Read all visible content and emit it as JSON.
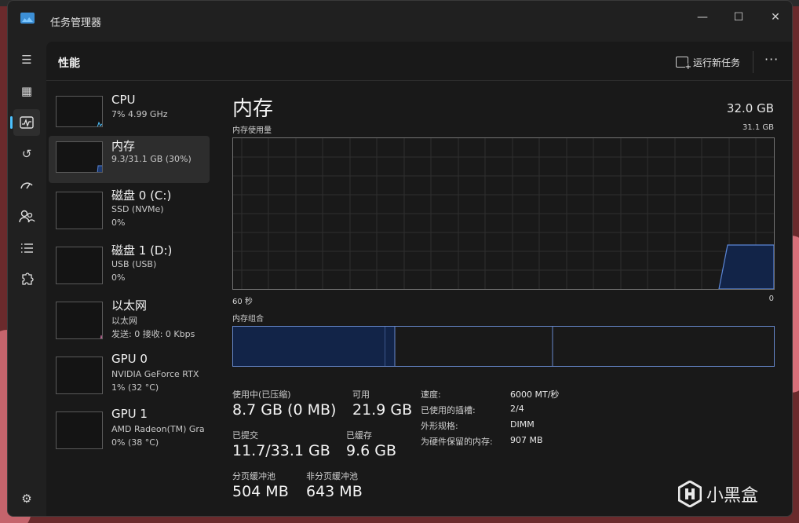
{
  "window": {
    "app_title": "任务管理器",
    "controls": {
      "minimize": "—",
      "maximize": "☐",
      "close": "✕"
    }
  },
  "rail": {
    "items": [
      {
        "icon": "hamburger-menu-icon",
        "glyph": "☰"
      },
      {
        "icon": "processes-icon",
        "glyph": "▦"
      },
      {
        "icon": "performance-icon",
        "glyph": "⌁",
        "active": true
      },
      {
        "icon": "app-history-icon",
        "glyph": "↺"
      },
      {
        "icon": "startup-apps-icon",
        "glyph": "⚡"
      },
      {
        "icon": "users-icon",
        "glyph": "👥"
      },
      {
        "icon": "details-icon",
        "glyph": "≡"
      },
      {
        "icon": "services-icon",
        "glyph": "⚙"
      }
    ],
    "settings_glyph": "⚙"
  },
  "header": {
    "title": "性能",
    "run_task_label": "运行新任务",
    "more_label": "···"
  },
  "devices": [
    {
      "name": "CPU",
      "sub1": "7% 4.99 GHz",
      "sub2": "",
      "active": false
    },
    {
      "name": "内存",
      "sub1": "9.3/31.1 GB (30%)",
      "sub2": "",
      "active": true
    },
    {
      "name": "磁盘 0 (C:)",
      "sub1": "SSD (NVMe)",
      "sub2": "0%",
      "active": false
    },
    {
      "name": "磁盘 1 (D:)",
      "sub1": "USB (USB)",
      "sub2": "0%",
      "active": false
    },
    {
      "name": "以太网",
      "sub1": "以太网",
      "sub2": "发送: 0 接收: 0 Kbps",
      "active": false
    },
    {
      "name": "GPU 0",
      "sub1": "NVIDIA GeForce RTX",
      "sub2": "1% (32 °C)",
      "active": false
    },
    {
      "name": "GPU 1",
      "sub1": "AMD Radeon(TM) Gra",
      "sub2": "0% (38 °C)",
      "active": false
    }
  ],
  "detail": {
    "title": "内存",
    "total": "32.0 GB",
    "usage_label": "内存使用量",
    "usage_max": "31.1 GB",
    "x_left": "60 秒",
    "x_right": "0",
    "composition_label": "内存组合",
    "stats": {
      "in_use_label": "使用中(已压缩)",
      "in_use_value": "8.7 GB (0 MB)",
      "available_label": "可用",
      "available_value": "21.9 GB",
      "committed_label": "已提交",
      "committed_value": "11.7/33.1 GB",
      "cached_label": "已缓存",
      "cached_value": "9.6 GB",
      "paged_label": "分页缓冲池",
      "paged_value": "504 MB",
      "nonpaged_label": "非分页缓冲池",
      "nonpaged_value": "643 MB"
    },
    "kv": [
      {
        "k": "速度:",
        "v": "6000 MT/秒"
      },
      {
        "k": "已使用的插槽:",
        "v": "2/4"
      },
      {
        "k": "外形规格:",
        "v": "DIMM"
      },
      {
        "k": "为硬件保留的内存:",
        "v": "907 MB"
      }
    ]
  },
  "watermark": {
    "text": "小黑盒"
  },
  "colors": {
    "accent": "#4cc2ff",
    "memory_line": "#5b86d6",
    "memory_fill": "#122448",
    "grid": "#2e2e2e"
  }
}
